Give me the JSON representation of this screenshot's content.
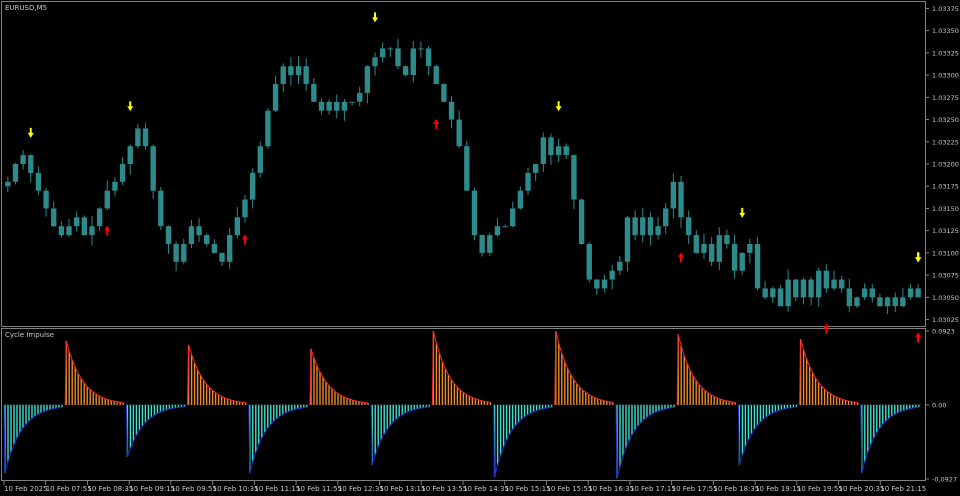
{
  "symbol_label": "EURUSD,M5",
  "indicator_label": "Cycle Impulse",
  "colors": {
    "background": "#000000",
    "frame": "#808080",
    "text": "#c8c8c8",
    "candle": "#2e8b8b",
    "arrow_up": "#ff0000",
    "arrow_down": "#ffff00",
    "hist_pos_fill": "#f08a2a",
    "hist_pos_line": "#ff2a2a",
    "hist_neg_fill": "#40e0d0",
    "hist_neg_line": "#1c2fd0"
  },
  "price_axis": {
    "ticks": [
      "1.03375",
      "1.03350",
      "1.03325",
      "1.03300",
      "1.03275",
      "1.03250",
      "1.03225",
      "1.03200",
      "1.03175",
      "1.03150",
      "1.03125",
      "1.03100",
      "1.03075",
      "1.03050",
      "1.03025"
    ]
  },
  "indicator_axis": {
    "ticks": [
      "0.0923",
      "0.00",
      "-0.0927"
    ]
  },
  "time_axis": {
    "ticks": [
      "10 Feb 2025",
      "10 Feb 07:55",
      "10 Feb 08:35",
      "10 Feb 09:15",
      "10 Feb 09:55",
      "10 Feb 10:35",
      "10 Feb 11:15",
      "10 Feb 11:55",
      "10 Feb 12:35",
      "10 Feb 13:15",
      "10 Feb 13:55",
      "10 Feb 14:35",
      "10 Feb 15:15",
      "10 Feb 15:55",
      "10 Feb 16:35",
      "10 Feb 17:15",
      "10 Feb 17:55",
      "10 Feb 18:35",
      "10 Feb 19:15",
      "10 Feb 19:55",
      "10 Feb 20:35",
      "10 Feb 21:15"
    ]
  },
  "chart_data": {
    "type": "candlestick",
    "symbol": "EURUSD",
    "timeframe": "M5",
    "ylim": [
      1.0302,
      1.0338
    ],
    "closes": [
      1.0318,
      1.032,
      1.0321,
      1.0319,
      1.0317,
      1.0315,
      1.0313,
      1.0312,
      1.0313,
      1.0314,
      1.0312,
      1.0313,
      1.0315,
      1.0317,
      1.0318,
      1.032,
      1.0322,
      1.0324,
      1.0322,
      1.0317,
      1.0313,
      1.0311,
      1.0309,
      1.0311,
      1.0313,
      1.0312,
      1.0311,
      1.031,
      1.0309,
      1.0312,
      1.0314,
      1.0316,
      1.0319,
      1.0322,
      1.0326,
      1.0329,
      1.0331,
      1.033,
      1.0331,
      1.0329,
      1.0327,
      1.0326,
      1.0327,
      1.0326,
      1.0327,
      1.0327,
      1.0328,
      1.0331,
      1.0332,
      1.0333,
      1.0333,
      1.0331,
      1.033,
      1.0333,
      1.0333,
      1.0331,
      1.0329,
      1.0327,
      1.0325,
      1.0322,
      1.0317,
      1.0312,
      1.031,
      1.0312,
      1.0313,
      1.0313,
      1.0315,
      1.0317,
      1.0319,
      1.032,
      1.0323,
      1.0321,
      1.0322,
      1.0321,
      1.0316,
      1.0311,
      1.0307,
      1.0306,
      1.0307,
      1.0308,
      1.0309,
      1.0314,
      1.0312,
      1.0314,
      1.0312,
      1.0313,
      1.0315,
      1.0318,
      1.0314,
      1.0312,
      1.031,
      1.0311,
      1.0309,
      1.0312,
      1.0311,
      1.0308,
      1.031,
      1.0311,
      1.0306,
      1.0305,
      1.0306,
      1.0304,
      1.0307,
      1.0305,
      1.0307,
      1.0305,
      1.0308,
      1.0306,
      1.0307,
      1.0306,
      1.0304,
      1.0305,
      1.0306,
      1.0305,
      1.0304,
      1.0305,
      1.0304,
      1.0305,
      1.0306,
      1.0305
    ],
    "signals": [
      {
        "type": "sell",
        "time": "10 Feb 07:30"
      },
      {
        "type": "sell",
        "time": "10 Feb 08:35"
      },
      {
        "type": "buy",
        "time": "10 Feb 08:20"
      },
      {
        "type": "buy",
        "time": "10 Feb 09:50"
      },
      {
        "type": "sell",
        "time": "10 Feb 11:15"
      },
      {
        "type": "buy",
        "time": "10 Feb 11:55"
      },
      {
        "type": "sell",
        "time": "10 Feb 13:15"
      },
      {
        "type": "buy",
        "time": "10 Feb 14:35"
      },
      {
        "type": "sell",
        "time": "10 Feb 15:15"
      },
      {
        "type": "buy",
        "time": "10 Feb 16:10"
      },
      {
        "type": "sell",
        "time": "10 Feb 17:15"
      },
      {
        "type": "buy",
        "time": "10 Feb 18:35"
      },
      {
        "type": "sell",
        "time": "10 Feb 18:55"
      },
      {
        "type": "buy",
        "time": "10 Feb 19:40"
      },
      {
        "type": "sell",
        "time": "10 Feb 20:05"
      }
    ],
    "indicator": {
      "name": "Cycle Impulse",
      "ylim": [
        -0.0927,
        0.0923
      ],
      "cycles": [
        {
          "sign": -1,
          "amplitude": 0.085
        },
        {
          "sign": 1,
          "amplitude": 0.08
        },
        {
          "sign": -1,
          "amplitude": 0.065
        },
        {
          "sign": 1,
          "amplitude": 0.075
        },
        {
          "sign": -1,
          "amplitude": 0.085
        },
        {
          "sign": 1,
          "amplitude": 0.07
        },
        {
          "sign": -1,
          "amplitude": 0.075
        },
        {
          "sign": 1,
          "amplitude": 0.092
        },
        {
          "sign": -1,
          "amplitude": 0.09
        },
        {
          "sign": 1,
          "amplitude": 0.092
        },
        {
          "sign": -1,
          "amplitude": 0.092
        },
        {
          "sign": 1,
          "amplitude": 0.088
        },
        {
          "sign": -1,
          "amplitude": 0.075
        },
        {
          "sign": 1,
          "amplitude": 0.082
        },
        {
          "sign": -1,
          "amplitude": 0.085
        }
      ]
    }
  }
}
